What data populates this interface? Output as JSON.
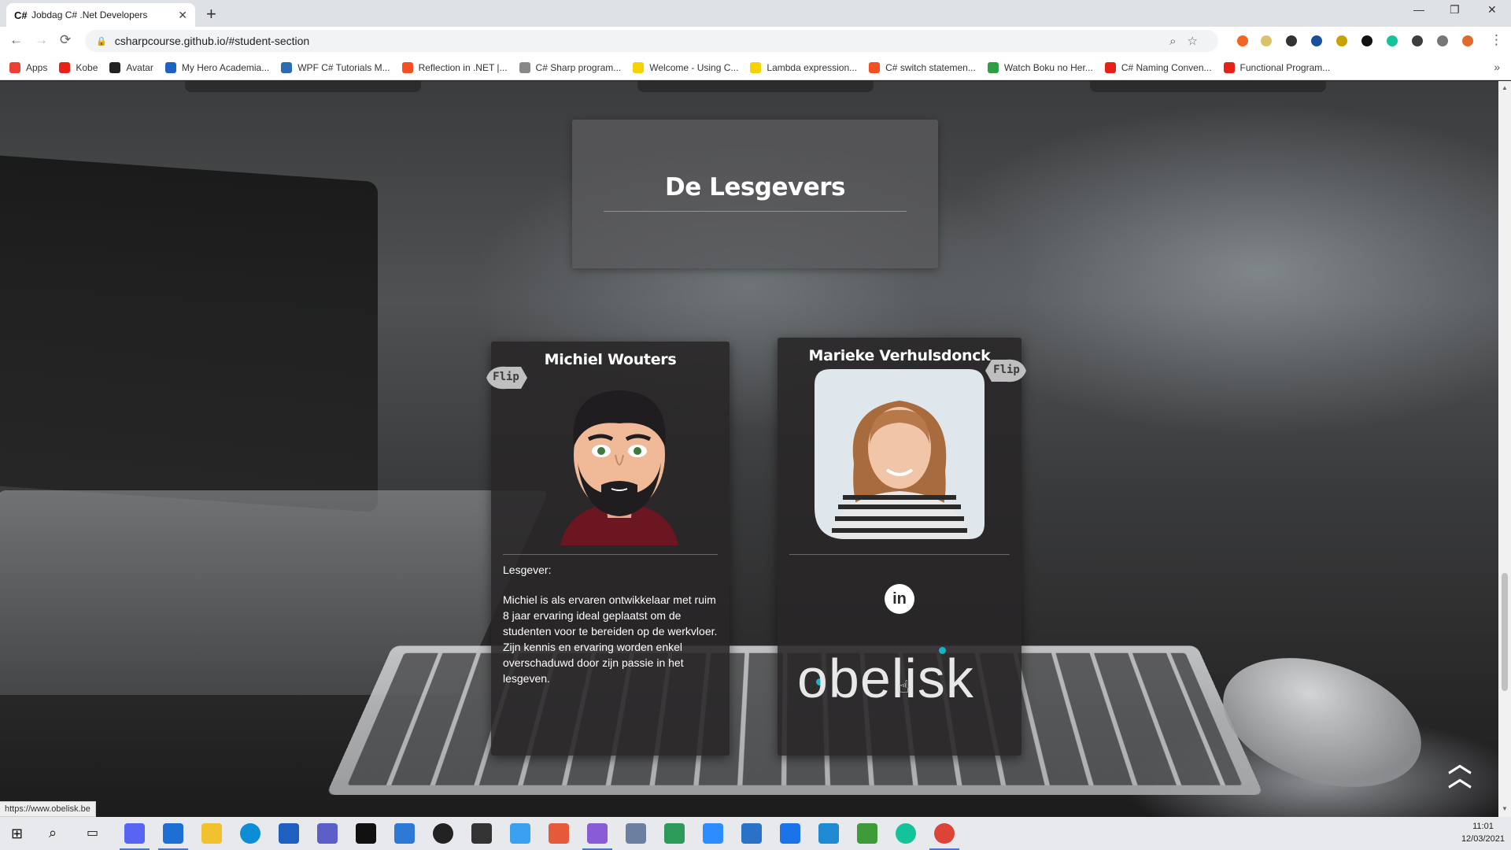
{
  "browser": {
    "tab": {
      "title": "Jobdag C# .Net Developers",
      "favicon": "C#"
    },
    "address": "csharpcourse.github.io/#student-section",
    "bookmarks": [
      {
        "label": "Apps",
        "color": "#e94235"
      },
      {
        "label": "Kobe",
        "color": "#e62117"
      },
      {
        "label": "Avatar",
        "color": "#222222"
      },
      {
        "label": "My Hero Academia...",
        "color": "#1e63c4"
      },
      {
        "label": "WPF C# Tutorials M...",
        "color": "#2b6cb0"
      },
      {
        "label": "Reflection in .NET |...",
        "color": "#f25022"
      },
      {
        "label": "C# Sharp program...",
        "color": "#888888"
      },
      {
        "label": "Welcome - Using C...",
        "color": "#f5d300"
      },
      {
        "label": "Lambda expression...",
        "color": "#f5d300"
      },
      {
        "label": "C# switch statemen...",
        "color": "#f25022"
      },
      {
        "label": "Watch Boku no Her...",
        "color": "#2ea043"
      },
      {
        "label": "C# Naming Conven...",
        "color": "#e62117"
      },
      {
        "label": "Functional Program...",
        "color": "#e62117"
      }
    ],
    "status_url": "https://www.obelisk.be"
  },
  "page": {
    "heading": "De Lesgevers",
    "cards": [
      {
        "name": "Michiel Wouters",
        "flip_label": "Flip",
        "role": "Lesgever:",
        "bio": "Michiel is als ervaren ontwikkelaar met ruim 8 jaar ervaring ideal geplaatst om de studenten voor te bereiden op de werkvloer. Zijn kennis en ervaring worden enkel overschaduwd door zijn passie in het lesgeven."
      },
      {
        "name": "Marieke Verhulsdonck",
        "flip_label": "Flip",
        "social": "in",
        "company_logo": "obelisk"
      }
    ]
  },
  "taskbar": {
    "time": "11:01",
    "date": "12/03/2021"
  }
}
